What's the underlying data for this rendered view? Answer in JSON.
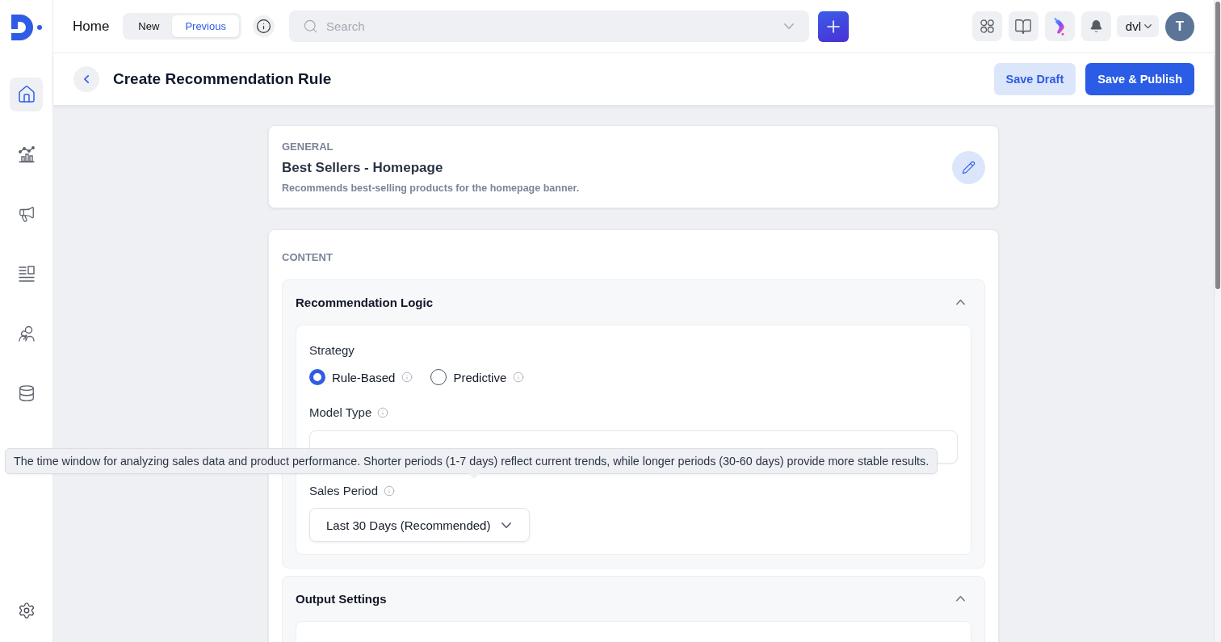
{
  "sidebar": {
    "items": [
      {
        "selected": true
      },
      {
        "selected": false
      },
      {
        "selected": false
      },
      {
        "selected": false
      },
      {
        "selected": false
      },
      {
        "selected": false
      }
    ]
  },
  "topbar": {
    "title": "Home",
    "view_toggle": [
      {
        "label": "New",
        "selected": false
      },
      {
        "label": "Previous",
        "selected": true
      }
    ],
    "search": {
      "placeholder": "Search"
    },
    "workspace": "dvl",
    "avatar": "T"
  },
  "header": {
    "title": "Create Recommendation Rule",
    "buttons": [
      {
        "label": "Save Draft",
        "kind": "secondary"
      },
      {
        "label": "Save & Publish",
        "kind": "primary"
      }
    ]
  },
  "general": {
    "heading": "GENERAL",
    "name": "Best Sellers - Homepage",
    "description": "Recommends best-selling products for the homepage banner."
  },
  "content": {
    "heading": "CONTENT",
    "sections": [
      {
        "title": "Recommendation Logic",
        "expanded": true,
        "fields": [
          {
            "kind": "radio",
            "label": "Strategy",
            "info": false,
            "options": [
              {
                "label": "Rule-Based",
                "info": true,
                "selected": true
              },
              {
                "label": "Predictive",
                "info": true,
                "selected": false
              }
            ]
          },
          {
            "kind": "field",
            "label": "Model Type",
            "info": true
          },
          {
            "kind": "select",
            "label": "Sales Period",
            "info": true,
            "value": "Last 30 Days (Recommended)"
          }
        ]
      },
      {
        "title": "Output Settings",
        "expanded": true
      }
    ]
  },
  "tooltip": {
    "text": "The time window for analyzing sales data and product performance. Shorter periods (1-7 days) reflect current trends, while longer periods (30-60 days) provide more stable results."
  }
}
